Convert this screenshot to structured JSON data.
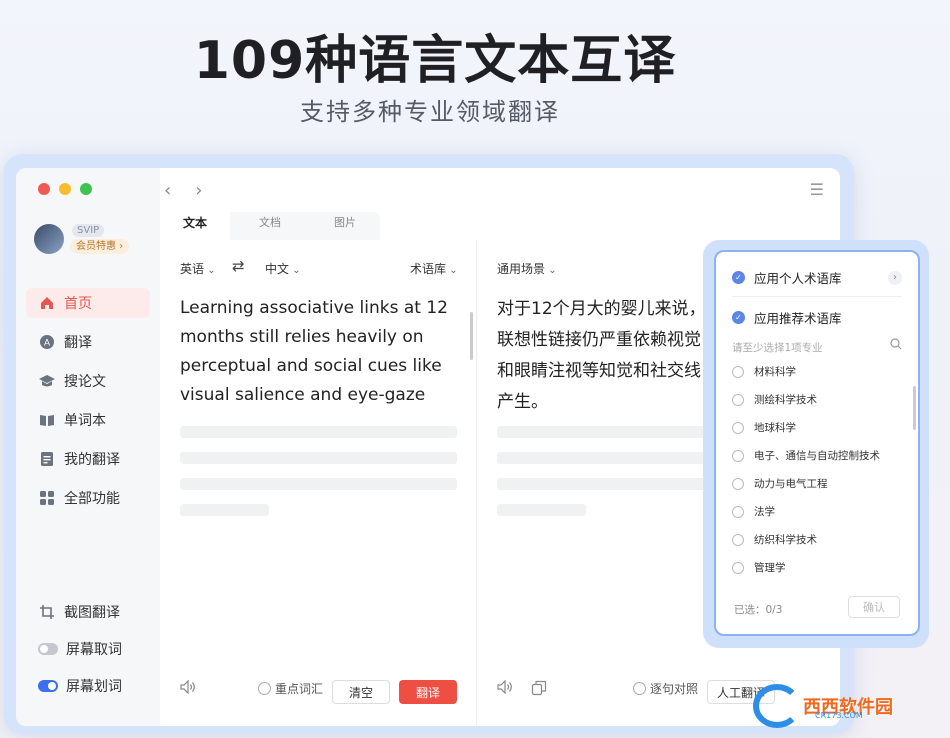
{
  "headline": "109种语言文本互译",
  "subhead": "支持多种专业领域翻译",
  "window": {
    "dot_colors": [
      "#f05a52",
      "#f6bd2f",
      "#3fc24f"
    ]
  },
  "sidebar": {
    "svip": "SVIP",
    "member_label": "会员特惠 ›",
    "items": [
      {
        "label": "首页",
        "icon": "home-icon"
      },
      {
        "label": "翻译",
        "icon": "translate-icon"
      },
      {
        "label": "搜论文",
        "icon": "graduation-cap-icon"
      },
      {
        "label": "单词本",
        "icon": "book-icon"
      },
      {
        "label": "我的翻译",
        "icon": "document-icon"
      },
      {
        "label": "全部功能",
        "icon": "grid-icon"
      }
    ],
    "bottom_items": [
      {
        "label": "截图翻译",
        "icon": "crop-icon"
      },
      {
        "label": "屏幕取词",
        "icon": "toggle-off-icon"
      },
      {
        "label": "屏幕划词",
        "icon": "toggle-on-icon"
      }
    ]
  },
  "tabs": [
    {
      "label": "文本"
    },
    {
      "label": "文档"
    },
    {
      "label": "图片"
    }
  ],
  "left_pane": {
    "source_lang": "英语",
    "target_lang": "中文",
    "glossary": "术语库",
    "source_text": "Learning associative links at 12 months still relies heavily on perceptual and social cues like visual salience and eye-gaze",
    "keyword_label": "重点词汇",
    "clear_label": "清空",
    "translate_label": "翻译"
  },
  "right_pane": {
    "scene": "通用场景",
    "lines": [
      "对于12个月大的婴儿来说，",
      "联想性链接仍严重依赖视觉",
      "和眼睛注视等知觉和社交线",
      "产生。"
    ],
    "sentence_label": "逐句对照",
    "human_label": "人工翻译"
  },
  "popup": {
    "option1": "应用个人术语库",
    "option2": "应用推荐术语库",
    "hint": "请至少选择1项专业",
    "categories": [
      "材料科学",
      "测绘科学技术",
      "地球科学",
      "电子、通信与自动控制技术",
      "动力与电气工程",
      "法学",
      "纺织科学技术",
      "管理学"
    ],
    "selected": "已选：0/3",
    "confirm": "确认"
  },
  "watermark": {
    "text": "西西软件园",
    "sub": "CR173.COM"
  },
  "colors": {
    "accent_red": "#ef4e42",
    "accent_blue": "#5b86e5",
    "active_bg": "#fdeaea"
  }
}
